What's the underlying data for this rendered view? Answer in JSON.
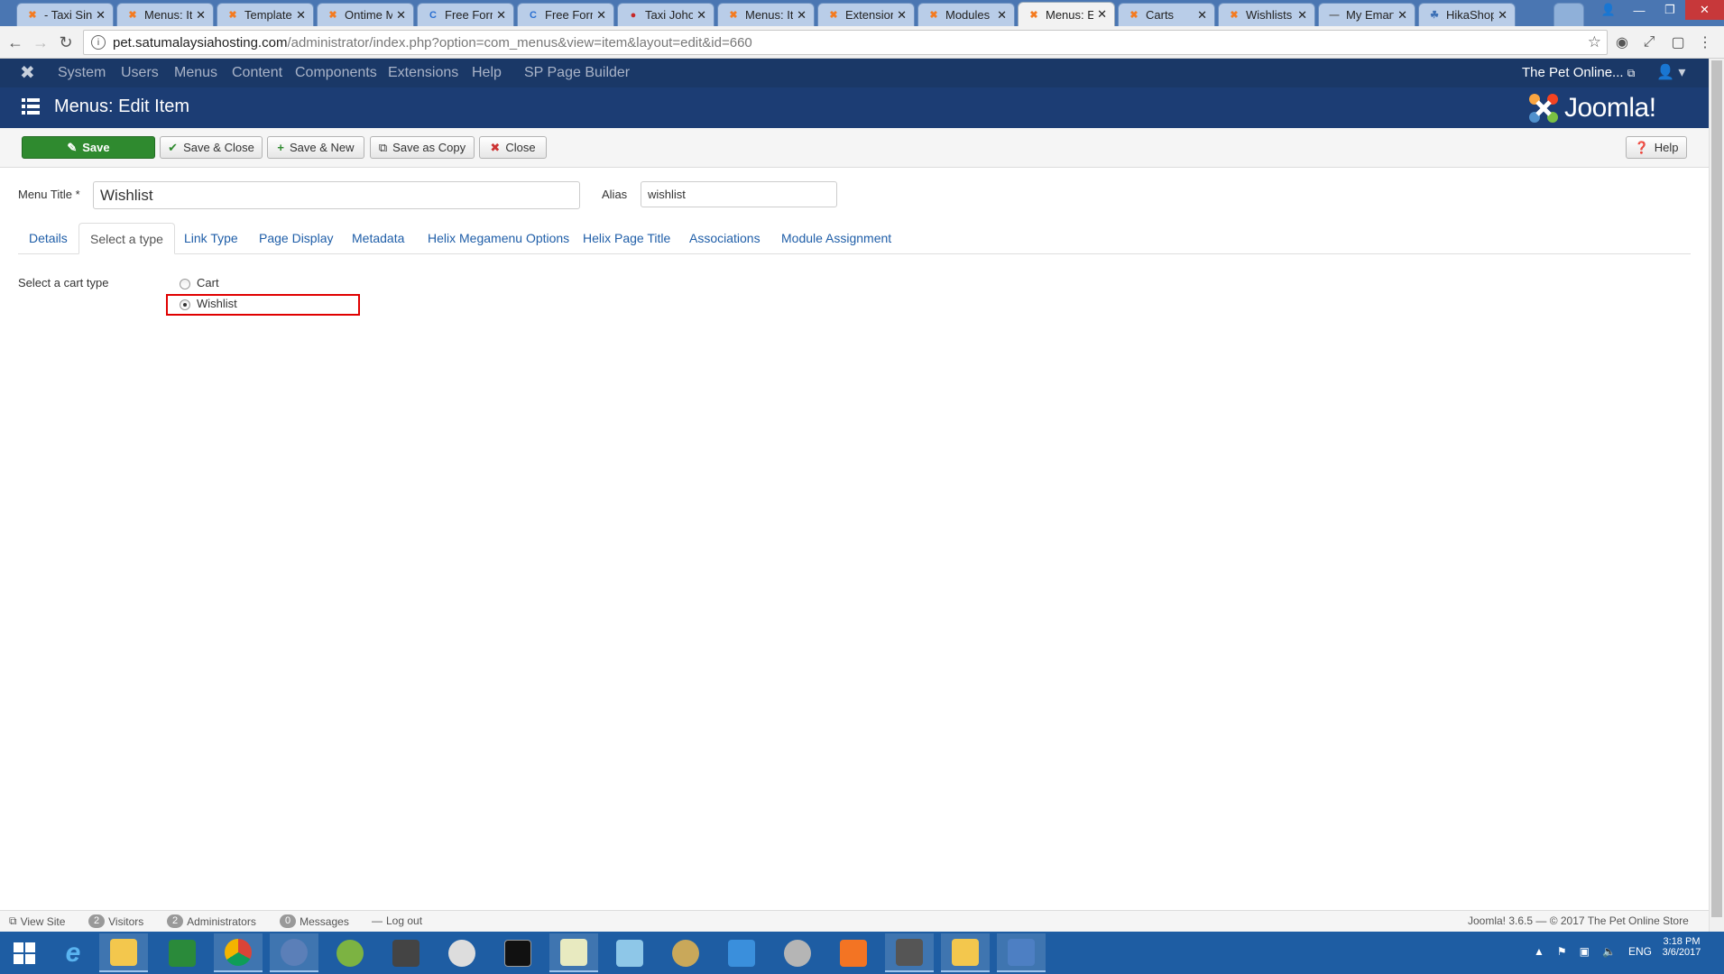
{
  "browser": {
    "tabs": [
      {
        "title": "- Taxi Sing",
        "icon": "joomla-icon"
      },
      {
        "title": "Menus: Ite",
        "icon": "joomla-icon"
      },
      {
        "title": "Templates",
        "icon": "joomla-icon"
      },
      {
        "title": "Ontime M",
        "icon": "joomla-icon"
      },
      {
        "title": "Free Form",
        "icon": "c-icon"
      },
      {
        "title": "Free Form",
        "icon": "c-icon"
      },
      {
        "title": "Taxi Johor",
        "icon": "taxi-icon"
      },
      {
        "title": "Menus: Ite",
        "icon": "joomla-icon"
      },
      {
        "title": "Extension",
        "icon": "joomla-icon"
      },
      {
        "title": "Modules (",
        "icon": "joomla-icon"
      },
      {
        "title": "Menus: Ed",
        "icon": "joomla-icon"
      },
      {
        "title": "Carts",
        "icon": "joomla-icon"
      },
      {
        "title": "Wishlists",
        "icon": "joomla-icon"
      },
      {
        "title": "My Emart",
        "icon": "dash-icon"
      },
      {
        "title": "HikaShop",
        "icon": "hikashop-icon"
      }
    ],
    "url_host": "pet.satumalaysiahosting.com",
    "url_path": "/administrator/index.php?option=com_menus&view=item&layout=edit&id=660"
  },
  "joomla": {
    "nav": {
      "items": [
        "System",
        "Users",
        "Menus",
        "Content",
        "Components",
        "Extensions",
        "Help",
        "SP Page Builder"
      ],
      "site_name": "The Pet Online..."
    },
    "page_title": "Menus: Edit Item",
    "logo_text": "Joomla!",
    "toolbar": {
      "save": "Save",
      "save_close": "Save & Close",
      "save_new": "Save & New",
      "save_copy": "Save as Copy",
      "close": "Close",
      "help": "Help"
    },
    "form": {
      "menu_title_label": "Menu Title *",
      "menu_title_value": "Wishlist",
      "alias_label": "Alias",
      "alias_value": "wishlist",
      "tabs": [
        "Details",
        "Select a type",
        "Link Type",
        "Page Display",
        "Metadata",
        "Helix Megamenu Options",
        "Helix Page Title",
        "Associations",
        "Module Assignment"
      ],
      "active_tab": "Select a type",
      "cart_type_label": "Select a cart type",
      "options": [
        "Cart",
        "Wishlist"
      ],
      "selected_option": "Wishlist"
    },
    "status": {
      "view_site": "View Site",
      "visitors_count": "2",
      "visitors": "Visitors",
      "admins_count": "2",
      "admins": "Administrators",
      "messages_count": "0",
      "messages": "Messages",
      "logout": "Log out",
      "copyright": "Joomla! 3.6.5 — © 2017 The Pet Online Store"
    }
  },
  "taskbar": {
    "time": "3:18 PM",
    "date": "3/6/2017",
    "lang": "ENG"
  },
  "colors": {
    "joomla_nav": "#1a3867",
    "joomla_header": "#1c3d74",
    "save_green": "#2f8a2f",
    "highlight_red": "#e00000",
    "link_blue": "#1f5ea8"
  }
}
